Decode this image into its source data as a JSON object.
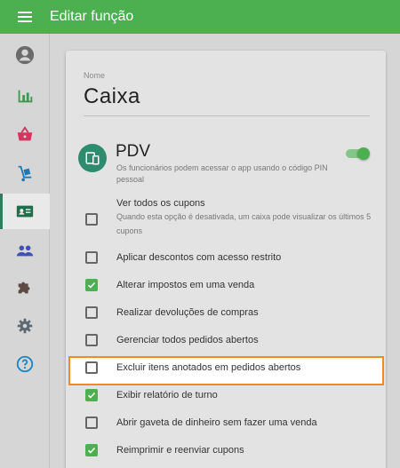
{
  "appbar": {
    "title": "Editar função",
    "menu_icon": "menu-icon"
  },
  "sidebar": {
    "items": [
      {
        "name": "account",
        "icon": "account-icon",
        "color": "#6b6b6b"
      },
      {
        "name": "reports",
        "icon": "bar-chart-icon",
        "color": "#3c9a4e"
      },
      {
        "name": "sales",
        "icon": "basket-icon",
        "color": "#d8325f"
      },
      {
        "name": "inventory",
        "icon": "hand-truck-icon",
        "color": "#1f7ab8"
      },
      {
        "name": "employees",
        "icon": "id-card-icon",
        "color": "#1f6d4a",
        "active": true
      },
      {
        "name": "customers",
        "icon": "people-icon",
        "color": "#3f51b5"
      },
      {
        "name": "integrations",
        "icon": "puzzle-icon",
        "color": "#5d4b43"
      },
      {
        "name": "settings",
        "icon": "gear-icon",
        "color": "#5e6a72"
      },
      {
        "name": "help",
        "icon": "help-icon",
        "color": "#1a86c7"
      }
    ]
  },
  "form": {
    "name_label": "Nome",
    "name_value": "Caixa",
    "pdv_title": "PDV",
    "pdv_description": "Os funcionários podem acessar o app usando o código PIN pessoal",
    "pdv_enabled": true
  },
  "permissions": [
    {
      "label": "Ver todos os cupons",
      "description": "Quando esta opção é desativada, um caixa pode visualizar os últimos 5 cupons",
      "checked": false
    },
    {
      "label": "Aplicar descontos com acesso restrito",
      "checked": false
    },
    {
      "label": "Alterar impostos em uma venda",
      "checked": true
    },
    {
      "label": "Realizar devoluções de compras",
      "checked": false
    },
    {
      "label": "Gerenciar todos pedidos abertos",
      "checked": false
    },
    {
      "label": "Excluir itens anotados em pedidos abertos",
      "checked": false,
      "highlighted": true
    },
    {
      "label": "Exibir relatório de turno",
      "checked": true
    },
    {
      "label": "Abrir gaveta de dinheiro sem fazer uma venda",
      "checked": false
    },
    {
      "label": "Reimprimir e reenviar cupons",
      "checked": true
    }
  ],
  "colors": {
    "primary": "#4caf50",
    "highlight_border": "#f08a24"
  }
}
